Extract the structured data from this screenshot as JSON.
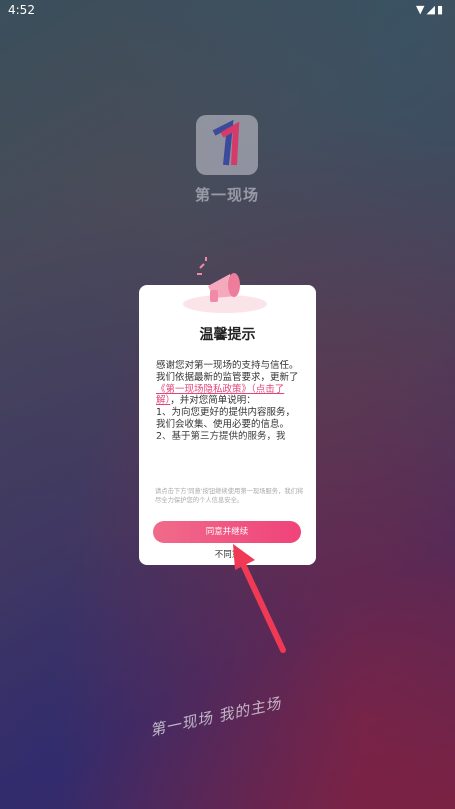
{
  "status_bar": {
    "time": "4:52"
  },
  "app": {
    "logo_text": "第一现场",
    "slogan": "第一现场 我的主场"
  },
  "dialog": {
    "title": "温馨提示",
    "line1": "感谢您对第一现场的支持与信任。",
    "line2_pre": "我们依据最新的监管要求，更新了",
    "policy_link": "《第一现场隐私政策》（点击了解）",
    "line2_post": "，并对您简单说明：",
    "item1": "1、为向您更好的提供内容服务，我们会收集、使用必要的信息。",
    "item2": "2、基于第三方提供的服务，我",
    "note": "请点击下方'同意'按钮继续使用第一现场服务，我们将尽全力保护您的个人信息安全。",
    "agree_label": "同意并继续",
    "disagree_label": "不同意"
  },
  "colors": {
    "accent": "#f0437a",
    "link": "#e0457b"
  }
}
